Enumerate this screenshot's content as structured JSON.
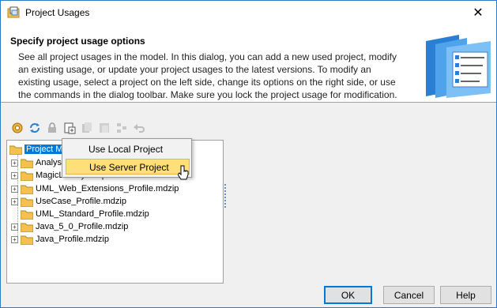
{
  "window": {
    "title": "Project Usages",
    "close_icon": "close-icon"
  },
  "header": {
    "title": "Specify project usage options",
    "description": "See all project usages in the model. In this dialog, you can add a new used project, modify an existing usage, or update your project usages to the latest versions. To modify an existing usage, select a project on the left side, change its options on the right side, or use the commands in the dialog toolbar. Make sure you lock the project usage for modification."
  },
  "toolbar": {
    "buttons": [
      "gear-icon",
      "refresh-icon",
      "lock-icon",
      "add-project-icon",
      "copy-icon",
      "paste-icon",
      "hierarchy-icon",
      "undo-icon"
    ]
  },
  "tree": {
    "root": "Project Ma",
    "items": [
      {
        "label": "Analys",
        "expandable": true
      },
      {
        "label": "MagicLibrary Requirements",
        "expandable": true
      },
      {
        "label": "UML_Web_Extensions_Profile.mdzip",
        "expandable": true
      },
      {
        "label": "UseCase_Profile.mdzip",
        "expandable": true
      },
      {
        "label": "UML_Standard_Profile.mdzip",
        "expandable": false
      },
      {
        "label": "Java_5_0_Profile.mdzip",
        "expandable": true
      },
      {
        "label": "Java_Profile.mdzip",
        "expandable": true
      }
    ]
  },
  "popup": {
    "items": [
      {
        "label": "Use Local Project",
        "highlighted": false
      },
      {
        "label": "Use Server Project",
        "highlighted": true
      }
    ]
  },
  "buttons": {
    "ok": "OK",
    "cancel": "Cancel",
    "help": "Help"
  },
  "colors": {
    "accent": "#0078d7",
    "highlight": "#fde07a",
    "folder": "#f2c14e"
  }
}
